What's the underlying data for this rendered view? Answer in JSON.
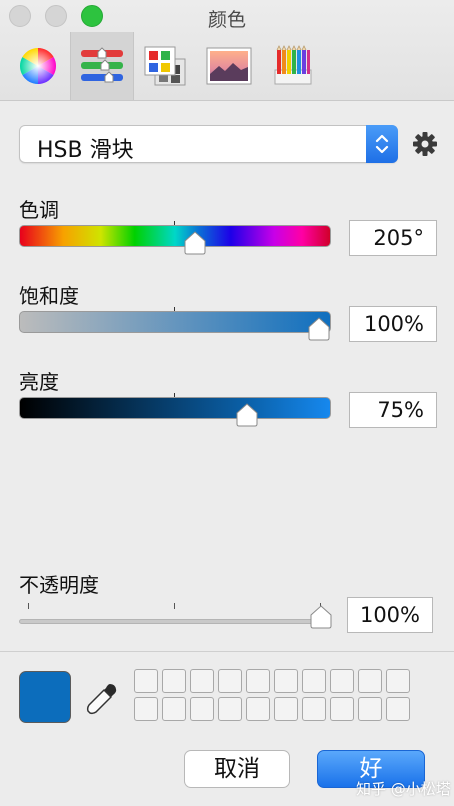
{
  "window": {
    "title": "颜色"
  },
  "toolbar": {
    "items": [
      {
        "name": "color-wheel",
        "active": false
      },
      {
        "name": "color-sliders",
        "active": true
      },
      {
        "name": "color-palettes",
        "active": false
      },
      {
        "name": "image-palettes",
        "active": false
      },
      {
        "name": "pencils",
        "active": false
      }
    ]
  },
  "picker": {
    "mode_label": "HSB 滑块"
  },
  "sliders": {
    "hue": {
      "label": "色调",
      "value_text": "205°",
      "value": 205
    },
    "saturation": {
      "label": "饱和度",
      "value_text": "100%",
      "value": 100
    },
    "brightness": {
      "label": "亮度",
      "value_text": "75%",
      "value": 75
    }
  },
  "opacity": {
    "label": "不透明度",
    "value_text": "100%",
    "value": 100
  },
  "current_color": "#0c6dbc",
  "buttons": {
    "cancel": "取消",
    "ok": "好"
  },
  "watermark": "知乎 @小松塔"
}
